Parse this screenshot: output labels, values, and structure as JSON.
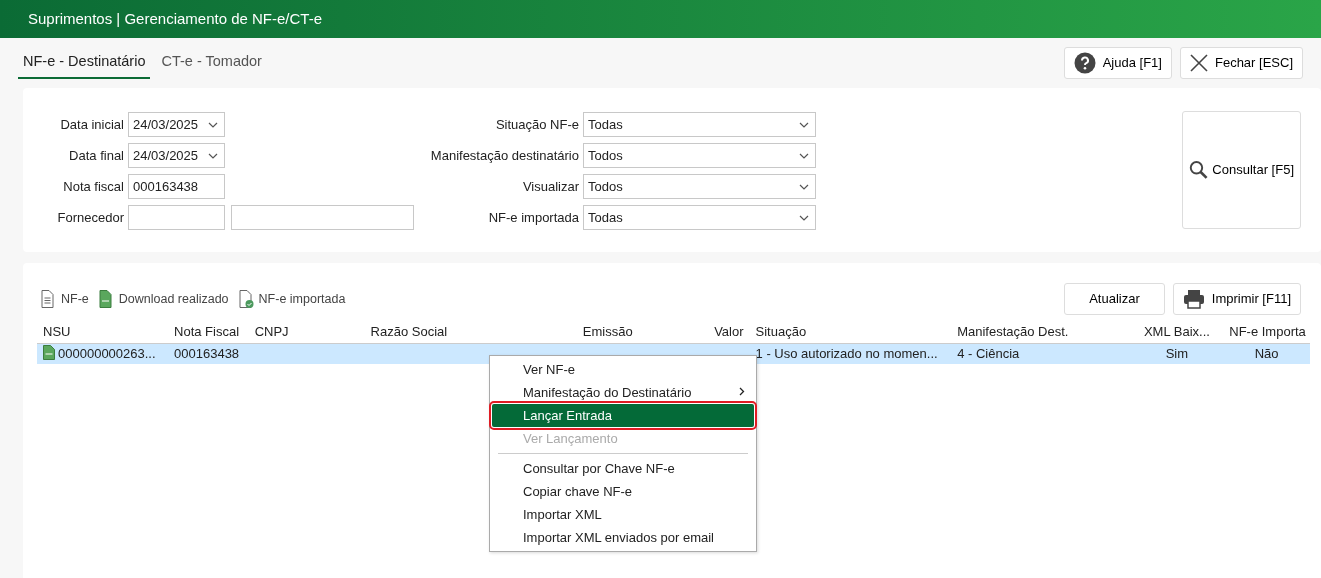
{
  "window": {
    "title": "Suprimentos | Gerenciamento de NF-e/CT-e"
  },
  "tabs": [
    {
      "label": "NF-e - Destinatário",
      "selected": true
    },
    {
      "label": "CT-e - Tomador",
      "selected": false
    }
  ],
  "header_buttons": [
    {
      "kind": "help",
      "label": "Ajuda [F1]"
    },
    {
      "kind": "close",
      "label": "Fechar [ESC]"
    }
  ],
  "filters": {
    "left": [
      {
        "label": "Data inicial",
        "value": "24/03/2025",
        "kind": "date"
      },
      {
        "label": "Data final",
        "value": "24/03/2025",
        "kind": "date"
      },
      {
        "label": "Nota fiscal",
        "value": "000163438",
        "kind": "text"
      },
      {
        "label": "Fornecedor",
        "kind": "pair"
      }
    ],
    "right": [
      {
        "label": "Situação NF-e",
        "value": "Todas"
      },
      {
        "label": "Manifestação destinatário",
        "value": "Todos"
      },
      {
        "label": "Visualizar",
        "value": "Todos"
      },
      {
        "label": "NF-e importada",
        "value": "Todas"
      }
    ],
    "search_button": "Consultar [F5]"
  },
  "legend": [
    {
      "kind": "doc",
      "label": "NF-e"
    },
    {
      "kind": "xml",
      "label": "Download realizado"
    },
    {
      "kind": "imported",
      "label": "NF-e importada"
    }
  ],
  "grid_buttons": [
    {
      "kind": "plain",
      "label": "Atualizar"
    },
    {
      "kind": "print",
      "label": "Imprimir [F11]"
    }
  ],
  "table": {
    "columns": [
      "NSU",
      "Nota Fiscal",
      "CNPJ",
      "Razão Social",
      "Emissão",
      "Valor",
      "Situação",
      "Manifestação Dest.",
      "XML Baix...",
      "NF-e Importa"
    ],
    "rows": [
      {
        "selected": true,
        "cells": [
          "000000000263...",
          "000163438",
          null,
          null,
          null,
          null,
          "1 - Uso autorizado no momen...",
          "4 - Ciência",
          "Sim",
          "Não"
        ]
      }
    ]
  },
  "context_menu": [
    {
      "kind": "item",
      "label": "Ver NF-e",
      "selected": false,
      "disabled": false,
      "submenu": false
    },
    {
      "kind": "item",
      "label": "Manifestação do Destinatário",
      "selected": false,
      "disabled": false,
      "submenu": true
    },
    {
      "kind": "item",
      "label": "Lançar Entrada",
      "selected": true,
      "disabled": false,
      "submenu": false
    },
    {
      "kind": "item",
      "label": "Ver Lançamento",
      "selected": false,
      "disabled": true,
      "submenu": false
    },
    {
      "kind": "separator"
    },
    {
      "kind": "item",
      "label": "Consultar por Chave NF-e",
      "selected": false,
      "disabled": false,
      "submenu": false
    },
    {
      "kind": "item",
      "label": "Copiar chave NF-e",
      "selected": false,
      "disabled": false,
      "submenu": false
    },
    {
      "kind": "item",
      "label": "Importar XML",
      "selected": false,
      "disabled": false,
      "submenu": false
    },
    {
      "kind": "item",
      "label": "Importar XML enviados por email",
      "selected": false,
      "disabled": false,
      "submenu": false
    }
  ]
}
